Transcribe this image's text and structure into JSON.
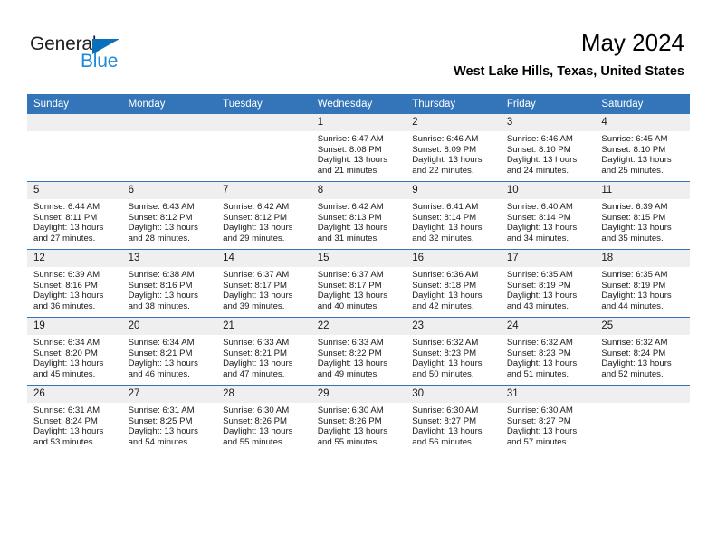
{
  "brand": {
    "name_part1": "General",
    "name_part2": "Blue",
    "triangle_icon": "triangle-icon",
    "color_dark": "#231f20",
    "color_blue": "#1c8ad6",
    "color_triangle": "#0c6fba"
  },
  "header": {
    "title": "May 2024",
    "subtitle": "West Lake Hills, Texas, United States"
  },
  "theme": {
    "header_blue": "#3375b8",
    "daynum_band": "#efefef",
    "text": "#1a1a1a"
  },
  "weekday_headers": [
    "Sunday",
    "Monday",
    "Tuesday",
    "Wednesday",
    "Thursday",
    "Friday",
    "Saturday"
  ],
  "weeks": [
    [
      {
        "day": "",
        "sunrise": "",
        "sunset": "",
        "daylight1": "",
        "daylight2": ""
      },
      {
        "day": "",
        "sunrise": "",
        "sunset": "",
        "daylight1": "",
        "daylight2": ""
      },
      {
        "day": "",
        "sunrise": "",
        "sunset": "",
        "daylight1": "",
        "daylight2": ""
      },
      {
        "day": "1",
        "sunrise": "Sunrise: 6:47 AM",
        "sunset": "Sunset: 8:08 PM",
        "daylight1": "Daylight: 13 hours",
        "daylight2": "and 21 minutes."
      },
      {
        "day": "2",
        "sunrise": "Sunrise: 6:46 AM",
        "sunset": "Sunset: 8:09 PM",
        "daylight1": "Daylight: 13 hours",
        "daylight2": "and 22 minutes."
      },
      {
        "day": "3",
        "sunrise": "Sunrise: 6:46 AM",
        "sunset": "Sunset: 8:10 PM",
        "daylight1": "Daylight: 13 hours",
        "daylight2": "and 24 minutes."
      },
      {
        "day": "4",
        "sunrise": "Sunrise: 6:45 AM",
        "sunset": "Sunset: 8:10 PM",
        "daylight1": "Daylight: 13 hours",
        "daylight2": "and 25 minutes."
      }
    ],
    [
      {
        "day": "5",
        "sunrise": "Sunrise: 6:44 AM",
        "sunset": "Sunset: 8:11 PM",
        "daylight1": "Daylight: 13 hours",
        "daylight2": "and 27 minutes."
      },
      {
        "day": "6",
        "sunrise": "Sunrise: 6:43 AM",
        "sunset": "Sunset: 8:12 PM",
        "daylight1": "Daylight: 13 hours",
        "daylight2": "and 28 minutes."
      },
      {
        "day": "7",
        "sunrise": "Sunrise: 6:42 AM",
        "sunset": "Sunset: 8:12 PM",
        "daylight1": "Daylight: 13 hours",
        "daylight2": "and 29 minutes."
      },
      {
        "day": "8",
        "sunrise": "Sunrise: 6:42 AM",
        "sunset": "Sunset: 8:13 PM",
        "daylight1": "Daylight: 13 hours",
        "daylight2": "and 31 minutes."
      },
      {
        "day": "9",
        "sunrise": "Sunrise: 6:41 AM",
        "sunset": "Sunset: 8:14 PM",
        "daylight1": "Daylight: 13 hours",
        "daylight2": "and 32 minutes."
      },
      {
        "day": "10",
        "sunrise": "Sunrise: 6:40 AM",
        "sunset": "Sunset: 8:14 PM",
        "daylight1": "Daylight: 13 hours",
        "daylight2": "and 34 minutes."
      },
      {
        "day": "11",
        "sunrise": "Sunrise: 6:39 AM",
        "sunset": "Sunset: 8:15 PM",
        "daylight1": "Daylight: 13 hours",
        "daylight2": "and 35 minutes."
      }
    ],
    [
      {
        "day": "12",
        "sunrise": "Sunrise: 6:39 AM",
        "sunset": "Sunset: 8:16 PM",
        "daylight1": "Daylight: 13 hours",
        "daylight2": "and 36 minutes."
      },
      {
        "day": "13",
        "sunrise": "Sunrise: 6:38 AM",
        "sunset": "Sunset: 8:16 PM",
        "daylight1": "Daylight: 13 hours",
        "daylight2": "and 38 minutes."
      },
      {
        "day": "14",
        "sunrise": "Sunrise: 6:37 AM",
        "sunset": "Sunset: 8:17 PM",
        "daylight1": "Daylight: 13 hours",
        "daylight2": "and 39 minutes."
      },
      {
        "day": "15",
        "sunrise": "Sunrise: 6:37 AM",
        "sunset": "Sunset: 8:17 PM",
        "daylight1": "Daylight: 13 hours",
        "daylight2": "and 40 minutes."
      },
      {
        "day": "16",
        "sunrise": "Sunrise: 6:36 AM",
        "sunset": "Sunset: 8:18 PM",
        "daylight1": "Daylight: 13 hours",
        "daylight2": "and 42 minutes."
      },
      {
        "day": "17",
        "sunrise": "Sunrise: 6:35 AM",
        "sunset": "Sunset: 8:19 PM",
        "daylight1": "Daylight: 13 hours",
        "daylight2": "and 43 minutes."
      },
      {
        "day": "18",
        "sunrise": "Sunrise: 6:35 AM",
        "sunset": "Sunset: 8:19 PM",
        "daylight1": "Daylight: 13 hours",
        "daylight2": "and 44 minutes."
      }
    ],
    [
      {
        "day": "19",
        "sunrise": "Sunrise: 6:34 AM",
        "sunset": "Sunset: 8:20 PM",
        "daylight1": "Daylight: 13 hours",
        "daylight2": "and 45 minutes."
      },
      {
        "day": "20",
        "sunrise": "Sunrise: 6:34 AM",
        "sunset": "Sunset: 8:21 PM",
        "daylight1": "Daylight: 13 hours",
        "daylight2": "and 46 minutes."
      },
      {
        "day": "21",
        "sunrise": "Sunrise: 6:33 AM",
        "sunset": "Sunset: 8:21 PM",
        "daylight1": "Daylight: 13 hours",
        "daylight2": "and 47 minutes."
      },
      {
        "day": "22",
        "sunrise": "Sunrise: 6:33 AM",
        "sunset": "Sunset: 8:22 PM",
        "daylight1": "Daylight: 13 hours",
        "daylight2": "and 49 minutes."
      },
      {
        "day": "23",
        "sunrise": "Sunrise: 6:32 AM",
        "sunset": "Sunset: 8:23 PM",
        "daylight1": "Daylight: 13 hours",
        "daylight2": "and 50 minutes."
      },
      {
        "day": "24",
        "sunrise": "Sunrise: 6:32 AM",
        "sunset": "Sunset: 8:23 PM",
        "daylight1": "Daylight: 13 hours",
        "daylight2": "and 51 minutes."
      },
      {
        "day": "25",
        "sunrise": "Sunrise: 6:32 AM",
        "sunset": "Sunset: 8:24 PM",
        "daylight1": "Daylight: 13 hours",
        "daylight2": "and 52 minutes."
      }
    ],
    [
      {
        "day": "26",
        "sunrise": "Sunrise: 6:31 AM",
        "sunset": "Sunset: 8:24 PM",
        "daylight1": "Daylight: 13 hours",
        "daylight2": "and 53 minutes."
      },
      {
        "day": "27",
        "sunrise": "Sunrise: 6:31 AM",
        "sunset": "Sunset: 8:25 PM",
        "daylight1": "Daylight: 13 hours",
        "daylight2": "and 54 minutes."
      },
      {
        "day": "28",
        "sunrise": "Sunrise: 6:30 AM",
        "sunset": "Sunset: 8:26 PM",
        "daylight1": "Daylight: 13 hours",
        "daylight2": "and 55 minutes."
      },
      {
        "day": "29",
        "sunrise": "Sunrise: 6:30 AM",
        "sunset": "Sunset: 8:26 PM",
        "daylight1": "Daylight: 13 hours",
        "daylight2": "and 55 minutes."
      },
      {
        "day": "30",
        "sunrise": "Sunrise: 6:30 AM",
        "sunset": "Sunset: 8:27 PM",
        "daylight1": "Daylight: 13 hours",
        "daylight2": "and 56 minutes."
      },
      {
        "day": "31",
        "sunrise": "Sunrise: 6:30 AM",
        "sunset": "Sunset: 8:27 PM",
        "daylight1": "Daylight: 13 hours",
        "daylight2": "and 57 minutes."
      },
      {
        "day": "",
        "sunrise": "",
        "sunset": "",
        "daylight1": "",
        "daylight2": ""
      }
    ]
  ]
}
